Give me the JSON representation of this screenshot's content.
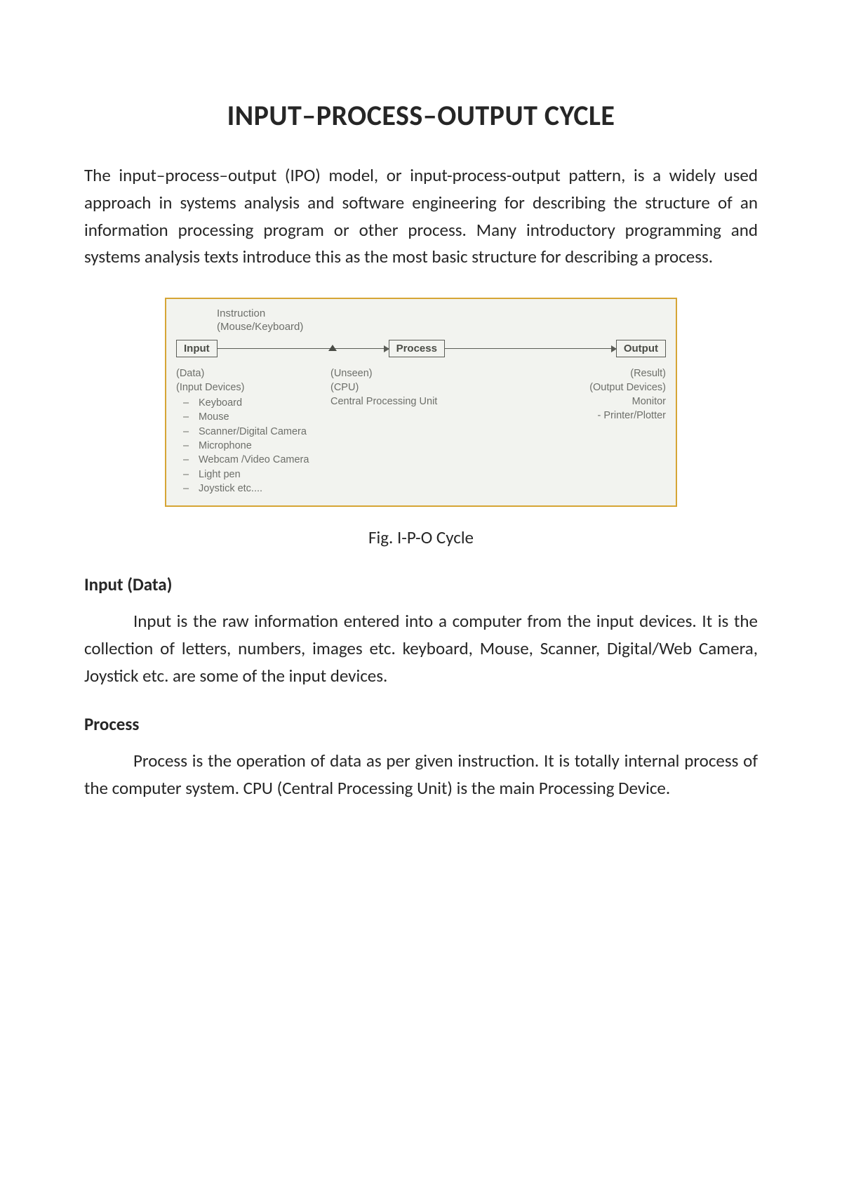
{
  "title": "INPUT–PROCESS–OUTPUT CYCLE",
  "intro": "The input–process–output (IPO) model, or input-process-output pattern, is a widely used approach in systems analysis and software engineering for describing the structure of an information processing program or other process. Many introductory programming and systems analysis texts introduce this as the most basic structure for describing a process.",
  "diagram": {
    "top_line1": "Instruction",
    "top_line2": "(Mouse/Keyboard)",
    "box_input": "Input",
    "box_process": "Process",
    "box_output": "Output",
    "col1": {
      "head1": "(Data)",
      "head2": "(Input Devices)",
      "items": [
        "Keyboard",
        "Mouse",
        "Scanner/Digital Camera",
        "Microphone",
        "Webcam /Video Camera",
        "Light pen",
        "Joystick etc...."
      ]
    },
    "col2": {
      "head1": "(Unseen)",
      "head2": "(CPU)",
      "line3": "Central Processing Unit"
    },
    "col3": {
      "head1": "(Result)",
      "head2": "(Output Devices)",
      "line3": "Monitor",
      "line4": "- Printer/Plotter"
    }
  },
  "caption": "Fig.  I-P-O Cycle",
  "sections": {
    "input": {
      "title": "Input (Data)",
      "body": "Input is the raw information entered into a computer from the input devices. It is the collection of letters, numbers, images etc. keyboard, Mouse, Scanner, Digital/Web Camera, Joystick etc. are some of the input devices."
    },
    "process": {
      "title": "Process",
      "body": "Process is the operation of data as per given instruction. It is totally internal process of the computer system. CPU (Central Processing Unit) is the main Processing Device."
    }
  }
}
